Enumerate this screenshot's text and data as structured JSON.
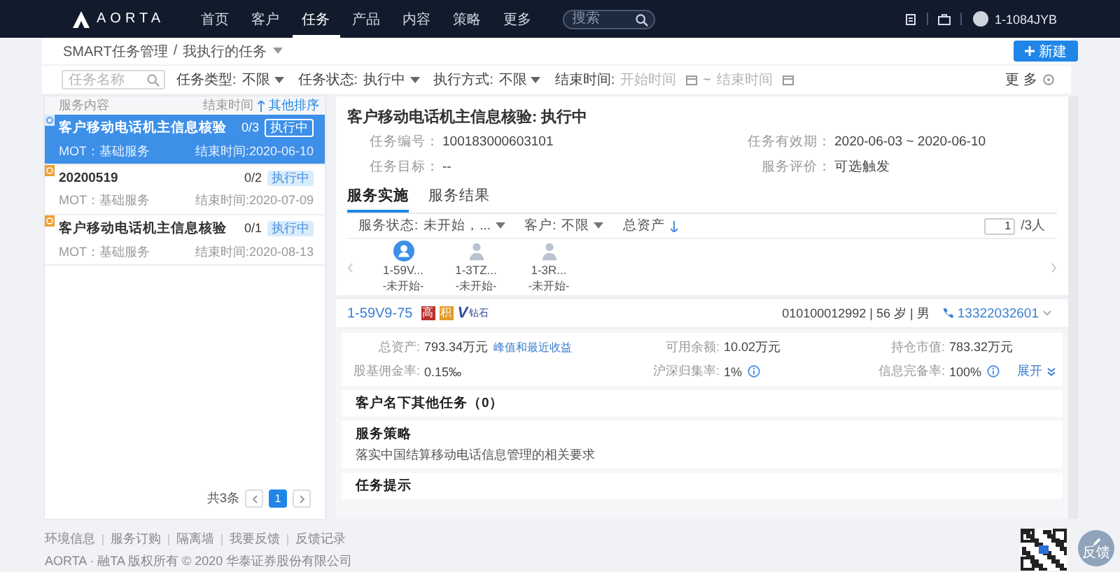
{
  "nav": {
    "logo": "AORTA",
    "items": [
      {
        "label": "首页",
        "selected": false
      },
      {
        "label": "客户",
        "selected": false
      },
      {
        "label": "任务",
        "selected": true
      },
      {
        "label": "产品",
        "selected": false
      },
      {
        "label": "内容",
        "selected": false
      },
      {
        "label": "策略",
        "selected": false
      },
      {
        "label": "更多",
        "selected": false
      }
    ],
    "search": {
      "placeholder": "搜索"
    },
    "user": "1-1084JYB"
  },
  "breadcrumb": {
    "items": [
      "SMART任务管理",
      "我执行的任务"
    ],
    "separator": "/",
    "new_button": "新建"
  },
  "filters": {
    "search": {
      "placeholder": "任务名称"
    },
    "selects": [
      {
        "label": "任务类型:",
        "value": "不限"
      },
      {
        "label": "任务状态:",
        "value": "执行中"
      },
      {
        "label": "执行方式:",
        "value": "不限"
      }
    ],
    "end_time": {
      "label": "结束时间:",
      "start_placeholder": "开始时间",
      "separator": "~",
      "end_placeholder": "结束时间"
    },
    "more": "更 多"
  },
  "task_list": {
    "columns": [
      "服务内容",
      "结束时间"
    ],
    "sort_link": "其他排序",
    "tasks": [
      {
        "title": "客户移动电话机主信息核验",
        "progress": "0/3",
        "status": "执行中",
        "category": "MOT：基础服务",
        "end": "结束时间:2020-06-10",
        "selected": true
      },
      {
        "title": "20200519",
        "progress": "0/2",
        "status": "执行中",
        "category": "MOT：基础服务",
        "end": "结束时间:2020-07-09",
        "selected": false
      },
      {
        "title": "客户移动电话机主信息核验",
        "progress": "0/1",
        "status": "执行中",
        "category": "MOT：基础服务",
        "end": "结束时间:2020-08-13",
        "selected": false
      }
    ],
    "pagination": {
      "total": "共3条",
      "pages": [
        {
          "label": "1",
          "selected": true
        }
      ]
    }
  },
  "detail": {
    "title": "客户移动电话机主信息核验: 执行中",
    "info_rows": [
      [
        {
          "label": "任务编号：",
          "value": "100183000603101"
        },
        {
          "label": "任务有效期：",
          "value": "2020-06-03 ~ 2020-06-10"
        }
      ],
      [
        {
          "label": "任务目标：",
          "value": "--"
        },
        {
          "label": "服务评价：",
          "value": "可选触发"
        }
      ]
    ],
    "tabs": [
      {
        "label": "服务实施",
        "selected": true
      },
      {
        "label": "服务结果",
        "selected": false
      }
    ],
    "filters": [
      {
        "label": "服务状态:",
        "value": "未开始，..."
      },
      {
        "label": "客户:",
        "value": "不限"
      }
    ],
    "sort": "总资产",
    "page": "1",
    "page_total": "/3人",
    "customers": [
      {
        "id": "1-59V...",
        "status": "-未开始-",
        "selected": true
      },
      {
        "id": "1-3TZ...",
        "status": "-未开始-",
        "selected": false
      },
      {
        "id": "1-3R...",
        "status": "-未开始-",
        "selected": false
      }
    ],
    "customer": {
      "id": "1-59V9-75",
      "badges": [
        {
          "text": "高",
          "color": "#b8322e"
        },
        {
          "text": "积",
          "color": "#e39a2a"
        }
      ],
      "vip": "V",
      "vip_level": "钻石",
      "info": "010100012992 | 56 岁 | 男",
      "phone": "13322032601"
    },
    "assets": [
      {
        "label": "总资产:",
        "value": "793.34万元",
        "link": "峰值和最近收益",
        "hint": false
      },
      {
        "label": "可用余额:",
        "value": "10.02万元",
        "hint": false
      },
      {
        "label": "持仓市值:",
        "value": "783.32万元",
        "hint": false
      },
      {
        "label": "股基佣金率:",
        "value": "0.15‰",
        "hint": false
      },
      {
        "label": "沪深归集率:",
        "value": "1%",
        "hint": true
      },
      {
        "label": "信息完备率:",
        "value": "100%",
        "hint": true
      }
    ],
    "expand": "展开",
    "sections": [
      {
        "title": "客户名下其他任务（0）"
      },
      {
        "title": "服务策略",
        "body": "落实中国结算移动电话信息管理的相关要求"
      },
      {
        "title": "任务提示"
      }
    ]
  },
  "footer": {
    "links": [
      "环境信息",
      "服务订购",
      "隔离墙",
      "我要反馈",
      "反馈记录"
    ],
    "copyright": "AORTA · 融TA 版权所有 © 2020 华泰证券股份有限公司",
    "feedback": "反馈"
  }
}
